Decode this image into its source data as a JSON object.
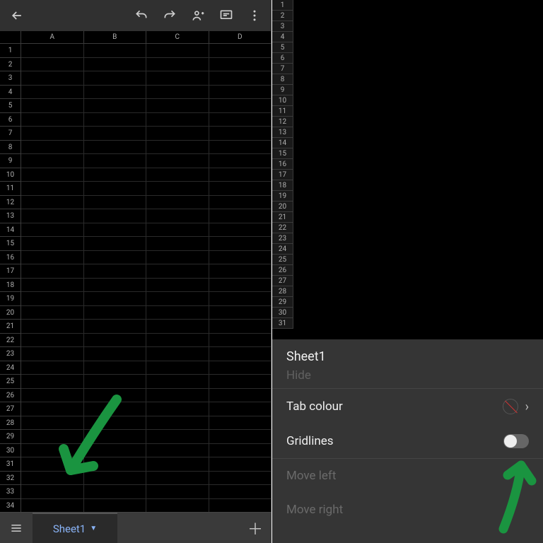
{
  "left": {
    "columns": [
      "A",
      "B",
      "C",
      "D"
    ],
    "rows": [
      1,
      2,
      3,
      4,
      5,
      6,
      7,
      8,
      9,
      10,
      11,
      12,
      13,
      14,
      15,
      16,
      17,
      18,
      19,
      20,
      21,
      22,
      23,
      24,
      25,
      26,
      27,
      28,
      29,
      30,
      31,
      32,
      33,
      34
    ],
    "active_sheet_tab": "Sheet1"
  },
  "right": {
    "rows": [
      1,
      2,
      3,
      4,
      5,
      6,
      7,
      8,
      9,
      10,
      11,
      12,
      13,
      14,
      15,
      16,
      17,
      18,
      19,
      20,
      21,
      22,
      23,
      24,
      25,
      26,
      27,
      28,
      29,
      30,
      31
    ],
    "menu": {
      "title": "Sheet1",
      "item_hide": "Hide",
      "item_tab_colour": "Tab colour",
      "item_gridlines": "Gridlines",
      "item_move_left": "Move left",
      "item_move_right": "Move right"
    }
  },
  "colors": {
    "accent_link": "#8ab4f8",
    "annotation_arrow": "#1a9440"
  }
}
